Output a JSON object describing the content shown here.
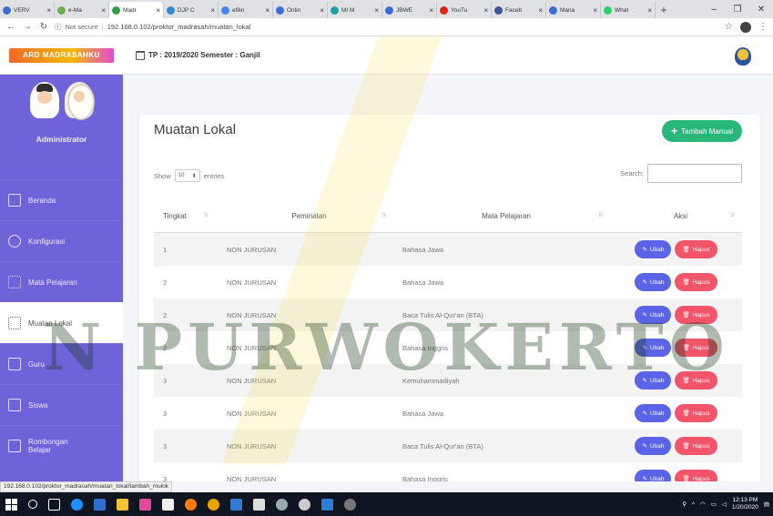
{
  "browser": {
    "tabs": [
      {
        "label": "VERV",
        "color": "#3b6fd8"
      },
      {
        "label": "e-Ma",
        "color": "#6ab04c"
      },
      {
        "label": "Madr",
        "color": "#2e9e4f",
        "active": true
      },
      {
        "label": "DJP C",
        "color": "#2d8cd8"
      },
      {
        "label": "efilin",
        "color": "#4285f4"
      },
      {
        "label": "Onlin",
        "color": "#3b6fd8"
      },
      {
        "label": "MI M",
        "color": "#1aa3a3"
      },
      {
        "label": "JBWE",
        "color": "#3b6fd8"
      },
      {
        "label": "YouTu",
        "color": "#e62117"
      },
      {
        "label": "Faceb",
        "color": "#3b5998"
      },
      {
        "label": "Mana",
        "color": "#3b6fd8"
      },
      {
        "label": "What",
        "color": "#25d366"
      }
    ],
    "url_security": "Not secure",
    "url": "192.168.0.102/proktor_madrasah/muatan_lokal",
    "status_url": "192.168.0.102/proktor_madrasah/muatan_lokal/tambah_mulok"
  },
  "topbar": {
    "logo_text": "ARD MADRASAHKU",
    "tp_info": "TP : 2019/2020 Semester : Ganjil"
  },
  "sidebar": {
    "role": "Administrator",
    "items": [
      {
        "label": "Beranda",
        "icon": "home-icon"
      },
      {
        "label": "Konfigurasi",
        "icon": "gear-icon"
      },
      {
        "label": "Mata Pelajaran",
        "icon": "grid-icon"
      },
      {
        "label": "Muatan Lokal",
        "icon": "grid-icon",
        "active": true
      },
      {
        "label": "Guru",
        "icon": "teacher-icon"
      },
      {
        "label": "Siswa",
        "icon": "student-icon"
      },
      {
        "label": "Rombongan Belajar",
        "icon": "folder-icon"
      }
    ]
  },
  "main": {
    "title": "Muatan Lokal",
    "add_button": "Tambah Manual",
    "show_label": "Show",
    "show_value": "10",
    "entries_label": "entries",
    "search_label": "Search:",
    "columns": [
      "Tingkat",
      "Peminatan",
      "Mata Pelajaran",
      "Aksi"
    ],
    "rows": [
      {
        "tingkat": "1",
        "peminatan": "NON JURUSAN",
        "mapel": "Bahasa Jawa"
      },
      {
        "tingkat": "2",
        "peminatan": "NON JURUSAN",
        "mapel": "Bahasa Jawa"
      },
      {
        "tingkat": "2",
        "peminatan": "NON JURUSAN",
        "mapel": "Baca Tulis Al-Qur'an (BTA)"
      },
      {
        "tingkat": "2",
        "peminatan": "NON JURUSAN",
        "mapel": "Bahasa Inggris"
      },
      {
        "tingkat": "3",
        "peminatan": "NON JURUSAN",
        "mapel": "Kemuhammadiyah"
      },
      {
        "tingkat": "3",
        "peminatan": "NON JURUSAN",
        "mapel": "Bahasa Jawa"
      },
      {
        "tingkat": "3",
        "peminatan": "NON JURUSAN",
        "mapel": "Baca Tulis Al-Qur'an (BTA)"
      },
      {
        "tingkat": "3",
        "peminatan": "NON JURUSAN",
        "mapel": "Bahasa Inggris"
      }
    ],
    "edit_label": "Ubah",
    "delete_label": "Hapus"
  },
  "watermark": "N PURWOKERTO",
  "taskbar": {
    "time": "12:13 PM",
    "date": "1/20/2020"
  },
  "colors": {
    "sidebar": "#6e63d9",
    "add_button": "#28b779",
    "edit_button": "#5b63e6",
    "delete_button": "#f2546a"
  }
}
